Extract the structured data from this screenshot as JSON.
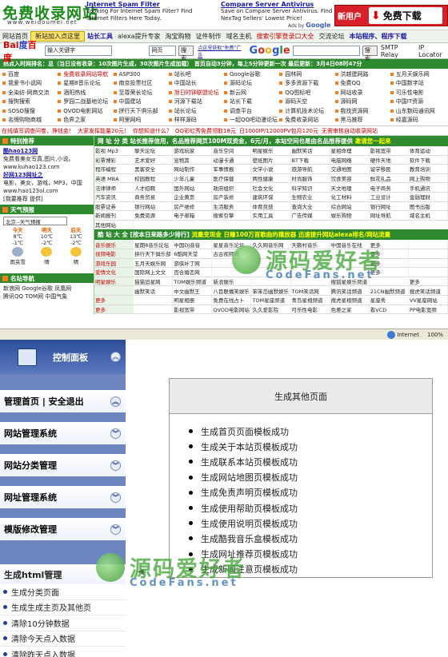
{
  "header": {
    "logo": "免费收录网站",
    "logo_url": "www.weidoumei.net",
    "ad1_title": "Internet Spam Filter",
    "ad1_body": "Looking For Internet Spam Filter? Find Internet Filters Here Today.",
    "ad2_title": "Compare Server Antivirus",
    "ad2_body": "Save on Compare Server Antivirus. Find NexTag Sellers' Lowest Price!",
    "ads_by": "Ads by",
    "ads_brand": "Google",
    "download_small": "新用户",
    "download_big": "免费下载"
  },
  "nav": {
    "items": [
      "网站首页",
      "新站加入点这里",
      "站长工具",
      "alexa提升专家",
      "淘宝购物",
      "证件制作",
      "域名主机",
      "搜索引擎登录口大全",
      "交流论坛",
      "本站程序、程序下载"
    ]
  },
  "search": {
    "baidu_a": "Bai",
    "baidu_b": "度",
    "baidu_c": "百度",
    "query": "输入关键字",
    "select": "网页",
    "button": "搜索",
    "link": "点这里获取“免费”广告",
    "google": "Google",
    "google_button": "搜索",
    "smtp1": "SMTP Relay",
    "smtp2": "IP Locator"
  },
  "ticker": "热点入时网排名：总（当日没有收录：10次图片生成，30次图片生成加载） 首页自动3分钟，每上5分钟更新一次 最后更新：3月4日08时47分",
  "quick_links": [
    "百度",
    "免费收录网站导航",
    "ASP300",
    "站长吧",
    "Google谷歌",
    "园林网",
    "洪越建网路",
    "五月天娱乐网",
    "我爱书小说网",
    "星期8音乐论坛",
    "南京投票社区",
    "中国站长",
    "源码论坛",
    "多多资源下载",
    "免费QQ",
    "中国数字站",
    "全染纺-网商交流",
    "酒阳热线",
    "至尊荣长论坛",
    "旭日时钟联盟论坛",
    "新云网",
    "QQ图标吧",
    "网站收录",
    "可乐性电影",
    "搜狗搜索",
    "罗园二战基地论坛",
    "中国建站",
    "河源下载站",
    "站长下载",
    "源码天空",
    "源码网",
    "中国IT资源",
    "SOSO搜搜",
    "QVOD电影网站",
    "拼行天下俱乐部",
    "站长论坛",
    "调查平台",
    "计算机技术论坛",
    "我找资源网",
    "山东数码通讯网",
    "名牌购物商城",
    "色界之家",
    "阿里网吗",
    "样样源码",
    "一起QQ吧动漫论坛",
    "免费收录网站",
    "黑马推荐",
    "经嘉源码"
  ],
  "promo": [
    "在线填写调查问卷，挣钱金！",
    "大家发挥能量20元！",
    "你想知道什么？",
    "QQ彩虹秀免费领取18元",
    "日1000IP/12000PV包月120元",
    "无需审核自动收录网站"
  ],
  "left": {
    "hot_title": "特别推荐",
    "hot1_name": "酷hao123网",
    "hot1_desc": "免费看美女写真,图片,小说。",
    "hot1_url": "www.kuhao123.com",
    "hot2_name": "好网123网址之",
    "hot2_desc": "电影，美女，游戏，MP3，中国",
    "hot2_url": "www.hao123ol.com",
    "hot_more": "[我要推荐 提供]",
    "weather_title": "天气预报",
    "weather_city": "北京--天气预报",
    "days": [
      "今天",
      "明天",
      "后天"
    ],
    "highs": [
      "8℃",
      "10℃",
      "13℃"
    ],
    "lows": [
      "-1℃",
      "-2℃",
      "-2℃"
    ],
    "conditions": [
      "雨夹雪",
      "晴",
      "晴"
    ],
    "nav_title": "名站导航",
    "nav_rows": [
      "新浪网 Google谷歌 凤凰网",
      "腾讯QQ TOM网 中国气象"
    ]
  },
  "main": {
    "head1": "网 址 分 类 站长推荐信用，名品推荐网页100M双资金，6元/月，本站空间也是由名品推荐提供",
    "head1_tail": "邀请您一起来",
    "cats1": [
      "影视 Mp3",
      "聊天论坛",
      "游戏玩家",
      "音乐空间",
      "明星娱乐",
      "幽默笑话",
      "星相命理",
      "影视宽带",
      "体育运动",
      "彩票博彩",
      "艺术爱好",
      "宠物其",
      "动漫卡通",
      "壁纸图片",
      "BT下载",
      "电脑网络",
      "硬件天地",
      "软件下载",
      "程序编程",
      "黑客安全",
      "网站制作",
      "军事情报",
      "文学小说",
      "旅游导航",
      "交通地图",
      "留学移民",
      "教育培训",
      "英语 MBA",
      "校园教程",
      "少年儿童",
      "医疗保健",
      "两性健康",
      "时尚服饰",
      "饮食美容",
      "鲜花礼品",
      "网上购物",
      "法律律师",
      "人才招聘",
      "国外网站",
      "政府组织",
      "社会文化",
      "科学知识",
      "天文地理",
      "电子商务",
      "手机通讯",
      "汽车资讯",
      "商务贸易",
      "企业黄页",
      "房产装修",
      "建筑环保",
      "生物农业",
      "化工材料",
      "工业设计",
      "金融理财",
      "股票证券",
      "银行网站",
      "房产维修",
      "生活服务",
      "体育竞技",
      "查询大全",
      "综合网站",
      "银行网址",
      "图书出版",
      "新闻报刊",
      "免费资源",
      "电子邮箱",
      "搜索引擎",
      "实用工具",
      "广告传媒",
      "娱乐购物",
      "网址导航",
      "域名主机",
      "其他网站"
    ],
    "head2": "酷 站 大 全 [按本日来路多少排行]",
    "head2_tail": "流量变现金 日赚100万首歌曲的播放器 迅速提升网站alexa排名/网站流量",
    "cats2": [
      "音乐娱乐",
      "星期8音乐论坛",
      "中国DJ音音",
      "星星音乐论坛",
      "久久网音乐网",
      "天籁村音乐",
      "中国音乐在线",
      "更多",
      "",
      "视频电影",
      "拼行天下俱乐部",
      "6酷网天堂",
      "古古视频网",
      "",
      "",
      "",
      "更多",
      "",
      "游戏乐园",
      "五月天娱乐网",
      "游侠补丁网",
      "",
      "",
      "",
      "",
      "更多",
      "",
      "爱情文化",
      "国际网上文文",
      "百合婚恋网",
      "",
      "",
      "",
      "",
      "更多",
      "",
      "明星娱乐",
      "猫猫追星网",
      "TOM娱乐频道",
      "新浪娱乐",
      "",
      "",
      "搜狐星娱乐频道",
      "",
      "更多",
      "",
      "幽默笑话",
      "中文幽默王",
      "八目联播笑娱乐",
      "笨笨岛幽默娱乐",
      "TOM笑话网",
      "腾讯笑话频道",
      "21CN幽默频道",
      "搜虎笑话频道",
      "更多",
      "",
      "明星相册",
      "免费在线占卜",
      "TOM星座频道",
      "青岛星相频道",
      "搜虎星相频道",
      "星座秀",
      "VV星座网站",
      "更多",
      "",
      "影视宽带",
      "QVOD电影网站",
      "久久爱影院",
      "可乐性电影",
      "色差之家",
      "看VCD",
      "PP电影宽频",
      "网易免费频道",
      "更多",
      "",
      "体育运动",
      "国家体育总局",
      "搜狐体育",
      "华体网",
      "TOM体育频道",
      "新浪体育",
      "腾讯体育",
      "体育风",
      "更多",
      ""
    ],
    "status_internet": "Internet",
    "status_zoom": "100%"
  },
  "watermark": {
    "text": "源码爱好者",
    "sub": "CodeFans.net"
  },
  "admin": {
    "title": "控制面板",
    "menus": [
      "管理首页 | 安全退出",
      "网站管理系统",
      "网站分类管理",
      "网址管理系统",
      "模版修改管理"
    ],
    "submenu_title": "生成html管理",
    "submenu_items": [
      "生成分类页面",
      "生成生成主页及其他页",
      "清除10分钟数据",
      "清除今天点入数据",
      "清除昨天点入数据",
      "清除总点入数据"
    ],
    "panel_title": "生成其他页面",
    "results": [
      "生成首页页面模板成功",
      "生成关于本站页模板成功",
      "生成联系本站页模板成功",
      "生成网站地图页模板成功",
      "生成免责声明页模板成功",
      "生成使用帮助页模板成功",
      "生成使用说明页模板成功",
      "生成酷我音乐盒模板成功",
      "生成网址推荐页模板成功",
      "生成新闻注意页模板成功"
    ]
  },
  "colors": {
    "green": "#2e8a2e",
    "red": "#d8202a",
    "admin_blue": "#6e86c0",
    "admin_dark": "#2c4f9a"
  }
}
